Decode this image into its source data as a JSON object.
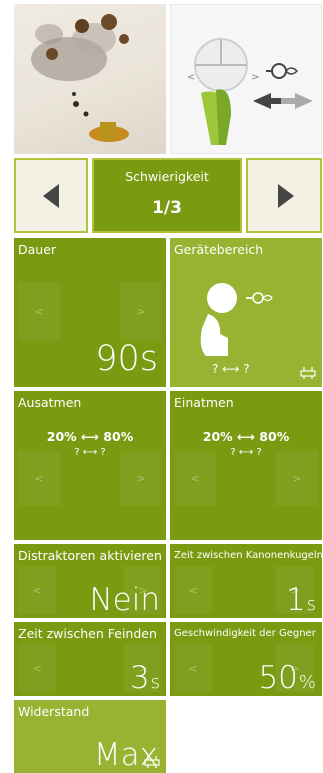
{
  "difficulty": {
    "label": "Schwierigkeit",
    "value": "1/3"
  },
  "settings": {
    "dauer": {
      "label": "Dauer",
      "value": "90s"
    },
    "geraetebereich": {
      "label": "Gerätebereich",
      "range": "? ⟷ ?"
    },
    "ausatmen": {
      "label": "Ausatmen",
      "range": "20% ⟷ 80%",
      "sub_range": "? ⟷ ?"
    },
    "einatmen": {
      "label": "Einatmen",
      "range": "20% ⟷ 80%",
      "sub_range": "? ⟷ ?"
    },
    "distraktoren": {
      "label": "Distraktoren aktivieren",
      "value": "Nein"
    },
    "kanonenkugeln": {
      "label": "Zeit zwischen Kanonenkugeln",
      "value": "1",
      "unit": "s"
    },
    "feinde": {
      "label": "Zeit zwischen Feinden",
      "value": "3",
      "unit": "s"
    },
    "gegner_speed": {
      "label": "Geschwindigkeit der Gegner",
      "value": "50",
      "unit": "%"
    },
    "widerstand": {
      "label": "Widerstand",
      "value": "Max"
    }
  },
  "nav_glyphs": {
    "prev": "<",
    "next": ">"
  },
  "colors": {
    "tile_dark": "#7a9a12",
    "tile_light": "#98b232",
    "border_accent": "#b2c23a",
    "arrow_bg": "#f2f1e4"
  }
}
